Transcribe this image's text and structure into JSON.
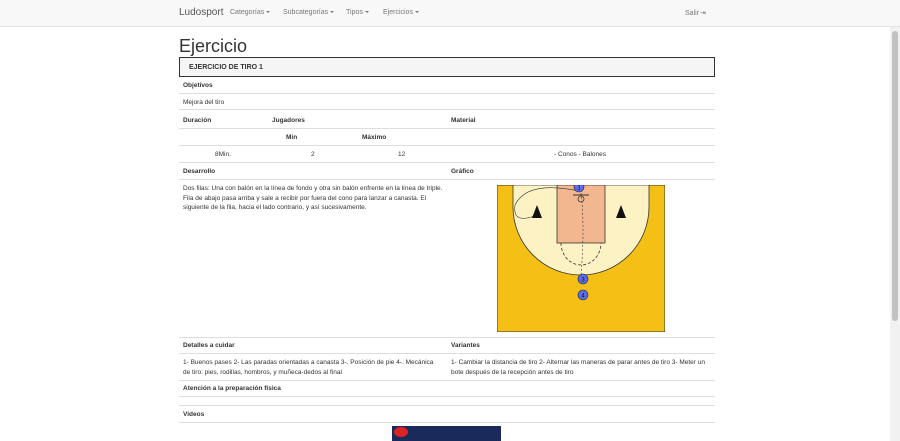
{
  "nav": {
    "brand": "Ludosport",
    "menus": [
      "Categorías",
      "Subcategorías",
      "Tipos",
      "Ejercicios"
    ],
    "logout": "Salir"
  },
  "page": {
    "title": "Ejercicio",
    "exercise_name": "EJERCICIO DE TIRO 1"
  },
  "sections": {
    "objetivos_label": "Objetivos",
    "objetivos_value": "Mejora del tiro",
    "duracion_label": "Duración",
    "jugadores_label": "Jugadores",
    "material_label": "Material",
    "min_label": "Min",
    "max_label": "Máximo",
    "duracion_value": "8Min.",
    "min_value": "2",
    "max_value": "12",
    "material_value": "- Conos - Balones",
    "desarrollo_label": "Desarrollo",
    "grafico_label": "Gráfico",
    "desarrollo_text": "Dos filas: Una con balón en la línea de fondo y otra sin balón enfrente en la línea de triple. Fila de abajo pasa arriba y sale a recibir por fuera del cono para lanzar a canasta. El siguiente de la fila, hacia el lado contrario, y así sucesivamente.",
    "detalles_label": "Detalles a cuidar",
    "variantes_label": "Variantes",
    "detalles_text": "1- Buenos pases 2- Las paradas orientadas a canasta 3-. Posición de pie 4-. Mecánica de tiro: pies, rodillas, hombros, y muñeca-dedos al final",
    "variantes_text": "1- Cambiar la distancia de tiro 2- Alternar las maneras de parar antes de tiro 3- Meter un bote después de la recepción antes de tiro",
    "atencion_label": "Atención a la preparación física",
    "videos_label": "Videos"
  },
  "diagram": {
    "player_labels": [
      "1",
      "3",
      "4"
    ],
    "colors": {
      "court": "#f5c016",
      "key": "#f3b78f",
      "arc": "#fdf2c4",
      "player": "#5b6cf0"
    }
  }
}
